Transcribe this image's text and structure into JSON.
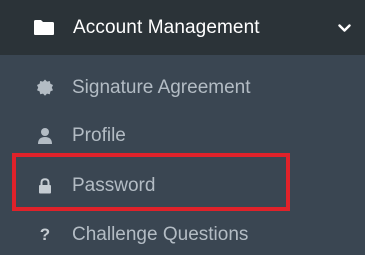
{
  "header": {
    "title": "Account Management",
    "icon": "folder-icon",
    "expand_icon": "chevron-down-icon",
    "bg_color": "#2b3338"
  },
  "submenu": {
    "bg_color": "#3a4652",
    "items": [
      {
        "label": "Signature Agreement",
        "icon": "seal-icon"
      },
      {
        "label": "Profile",
        "icon": "user-icon"
      },
      {
        "label": "Password",
        "icon": "lock-icon"
      },
      {
        "label": "Challenge Questions",
        "icon": "question-icon",
        "glyph": "?"
      }
    ]
  },
  "annotation": {
    "highlight_color": "#e0222a",
    "highlighted_item": "Password"
  }
}
